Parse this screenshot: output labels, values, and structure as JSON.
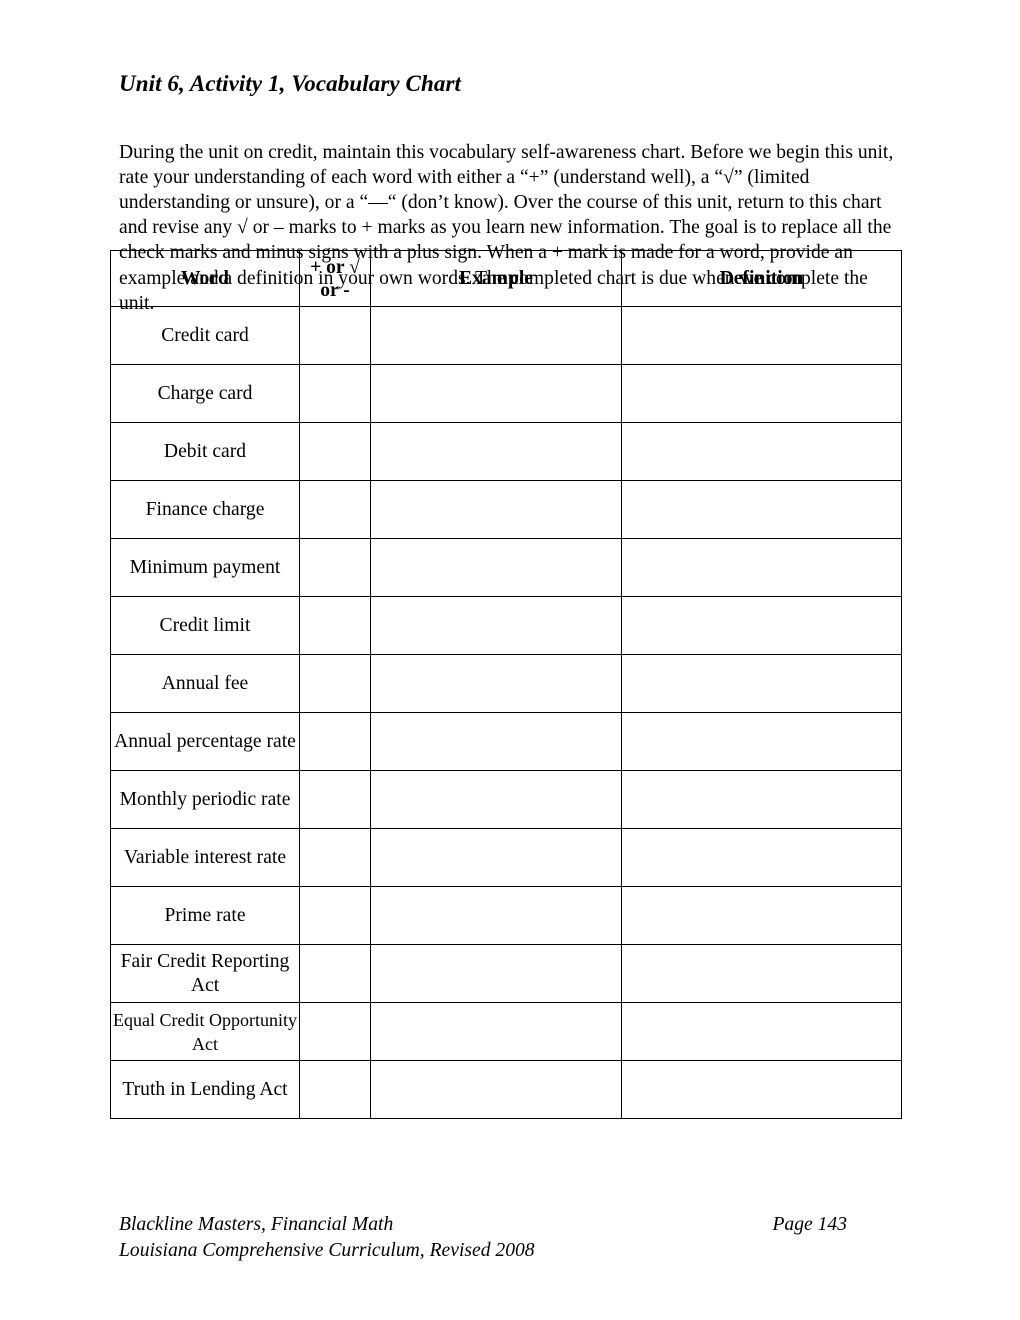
{
  "document": {
    "title": "Unit 6, Activity 1, Vocabulary Chart",
    "intro": "During the unit on credit, maintain this vocabulary self-awareness chart. Before we begin this unit, rate your understanding of each word with either a “+” (understand well), a “√” (limited understanding or unsure), or a “—“ (don’t know).  Over the course of this unit, return to this chart and revise any √ or – marks to + marks as you learn new information.  The goal is to replace all the check marks and minus signs with a plus sign.  When a + mark is made for a word, provide an example and a definition in your own words. The completed chart is due when we complete the unit."
  },
  "table": {
    "headers": {
      "word": "Word",
      "mark_line1": "+ or √",
      "mark_line2": "or -",
      "example": "Example",
      "definition": "Definition"
    },
    "rows": [
      {
        "word": "Credit card",
        "mark": "",
        "example": "",
        "definition": ""
      },
      {
        "word": "Charge card",
        "mark": "",
        "example": "",
        "definition": ""
      },
      {
        "word": "Debit card",
        "mark": "",
        "example": "",
        "definition": ""
      },
      {
        "word": "Finance charge",
        "mark": "",
        "example": "",
        "definition": ""
      },
      {
        "word": "Minimum payment",
        "mark": "",
        "example": "",
        "definition": ""
      },
      {
        "word": "Credit limit",
        "mark": "",
        "example": "",
        "definition": ""
      },
      {
        "word": "Annual fee",
        "mark": "",
        "example": "",
        "definition": ""
      },
      {
        "word": "Annual percentage rate",
        "mark": "",
        "example": "",
        "definition": ""
      },
      {
        "word": "Monthly periodic rate",
        "mark": "",
        "example": "",
        "definition": ""
      },
      {
        "word": "Variable interest rate",
        "mark": "",
        "example": "",
        "definition": ""
      },
      {
        "word": "Prime rate",
        "mark": "",
        "example": "",
        "definition": ""
      },
      {
        "word": "Fair Credit Reporting Act",
        "mark": "",
        "example": "",
        "definition": ""
      },
      {
        "word": "Equal Credit Opportunity Act",
        "mark": "",
        "example": "",
        "definition": ""
      },
      {
        "word": "Truth in Lending Act",
        "mark": "",
        "example": "",
        "definition": ""
      }
    ]
  },
  "footer": {
    "line1": "Blackline Masters, Financial Math",
    "page": "Page 143",
    "line2": "Louisiana Comprehensive Curriculum, Revised 2008"
  }
}
